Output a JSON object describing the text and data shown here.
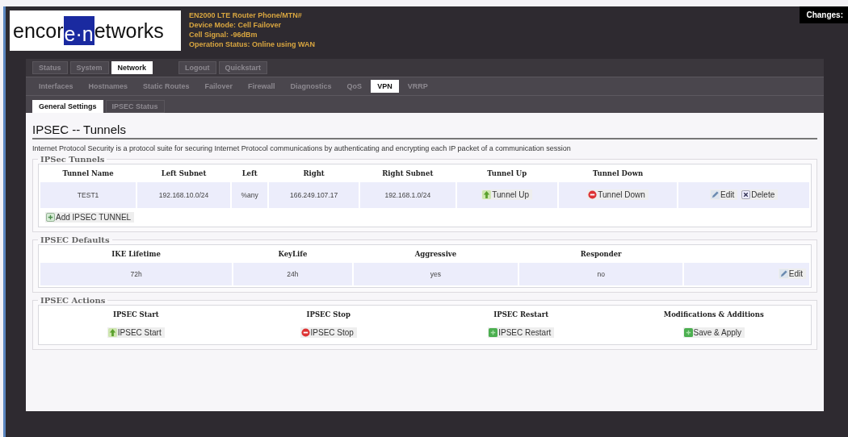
{
  "header": {
    "logo": {
      "left": "encor",
      "mark": "e·n",
      "right": "etworks"
    },
    "info": [
      "EN2000 LTE Router Phone/MTN#",
      "Device Mode: Cell Failover",
      "Cell Signal: -96dBm",
      "Operation Status: Online using WAN"
    ],
    "changes": "Changes:"
  },
  "main_tabs": [
    {
      "label": "Status",
      "selected": false
    },
    {
      "label": "System",
      "selected": false
    },
    {
      "label": "Network",
      "selected": true
    }
  ],
  "account_tabs": [
    {
      "label": "Logout",
      "selected": false
    },
    {
      "label": "Quickstart",
      "selected": false
    }
  ],
  "sub_tabs": [
    {
      "label": "Interfaces",
      "selected": false
    },
    {
      "label": "Hostnames",
      "selected": false
    },
    {
      "label": "Static Routes",
      "selected": false
    },
    {
      "label": "Failover",
      "selected": false
    },
    {
      "label": "Firewall",
      "selected": false
    },
    {
      "label": "Diagnostics",
      "selected": false
    },
    {
      "label": "QoS",
      "selected": false
    },
    {
      "label": "VPN",
      "selected": true
    },
    {
      "label": "VRRP",
      "selected": false
    }
  ],
  "section_tabs": [
    {
      "label": "General Settings",
      "selected": true
    },
    {
      "label": "IPSEC Status",
      "selected": false
    }
  ],
  "page": {
    "title": "IPSEC -- Tunnels",
    "description": "Internet Protocol Security is a protocol suite for securing Internet Protocol communications by authenticating and encrypting each IP packet of a communication session"
  },
  "tunnels": {
    "legend": "IPSec Tunnels",
    "columns": [
      "Tunnel Name",
      "Left Subnet",
      "Left",
      "Right",
      "Right Subnet",
      "Tunnel Up",
      "Tunnel Down"
    ],
    "rows": [
      {
        "cells": [
          "TEST1",
          "192.168.10.0/24",
          "%any",
          "166.249.107.17",
          "192.168.1.0/24"
        ],
        "buttons": [
          [
            {
              "label": "Tunnel Up",
              "kind": "up"
            }
          ],
          [
            {
              "label": "Tunnel Down",
              "kind": "stop"
            }
          ],
          [
            {
              "label": "Edit",
              "kind": "edit"
            },
            {
              "label": "Delete",
              "kind": "delete"
            }
          ]
        ]
      }
    ],
    "add_button": {
      "label": "Add IPSEC TUNNEL",
      "kind": "add"
    }
  },
  "defaults": {
    "legend": "IPSEC Defaults",
    "columns": [
      "IKE Lifetime",
      "KeyLife",
      "Aggressive",
      "Responder"
    ],
    "values": [
      "72h",
      "24h",
      "yes",
      "no"
    ],
    "button": {
      "label": "Edit",
      "kind": "edit"
    }
  },
  "actions": {
    "legend": "IPSEC Actions",
    "items": [
      {
        "heading": "IPSEC Start",
        "button": {
          "label": "IPSEC Start",
          "kind": "up"
        }
      },
      {
        "heading": "IPSEC Stop",
        "button": {
          "label": "IPSEC Stop",
          "kind": "stop"
        }
      },
      {
        "heading": "IPSEC Restart",
        "button": {
          "label": "IPSEC Restart",
          "kind": "restart"
        }
      },
      {
        "heading": "Modifications & Additions",
        "button": {
          "label": "Save & Apply",
          "kind": "save"
        }
      }
    ]
  }
}
